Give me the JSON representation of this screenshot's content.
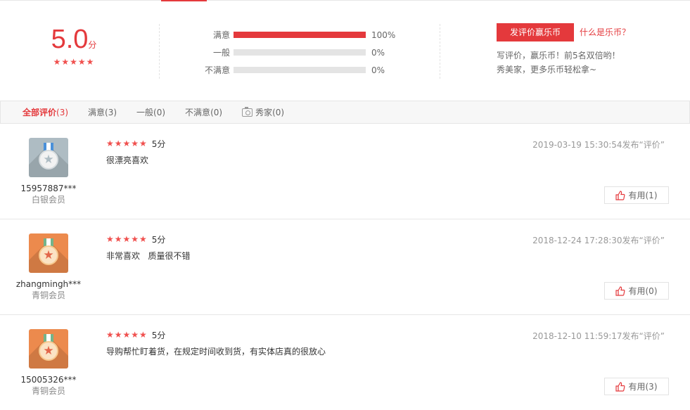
{
  "summary": {
    "score": "5.0",
    "score_unit": "分",
    "stars": "★★★★★",
    "bars": [
      {
        "label": "满意",
        "percent_text": "100%",
        "fill": 1.0
      },
      {
        "label": "一般",
        "percent_text": "0%",
        "fill": 0
      },
      {
        "label": "不满意",
        "percent_text": "0%",
        "fill": 0
      }
    ],
    "promo": {
      "button": "发评价赢乐币",
      "link": "什么是乐币？",
      "line1": "写评价，赢乐币！前5名双倍哟！",
      "line2": "秀美家，更多乐币轻松拿~"
    }
  },
  "tabs": [
    {
      "label": "全部评价",
      "count": "(3)"
    },
    {
      "label": "满意",
      "count": "(3)"
    },
    {
      "label": "一般",
      "count": "(0)"
    },
    {
      "label": "不满意",
      "count": "(0)"
    },
    {
      "label": "秀家",
      "count": "(0)",
      "icon": "camera-icon"
    }
  ],
  "reviews": [
    {
      "user": "15957887***",
      "level": "白银会员",
      "badge": "silver",
      "stars": "★★★★★",
      "score": "5分",
      "text": "很漂亮喜欢",
      "time": "2019-03-19 15:30:54发布“评价”",
      "useful_label": "有用",
      "useful_count": "(1)"
    },
    {
      "user": "zhangmingh***",
      "level": "青铜会员",
      "badge": "bronze",
      "stars": "★★★★★",
      "score": "5分",
      "text": "非常喜欢   质量很不错",
      "time": "2018-12-24 17:28:30发布“评价”",
      "useful_label": "有用",
      "useful_count": "(0)"
    },
    {
      "user": "15005326***",
      "level": "青铜会员",
      "badge": "bronze",
      "stars": "★★★★★",
      "score": "5分",
      "text": "导购帮忙盯着货，在规定时间收到货，有实体店真的很放心",
      "time": "2018-12-10 11:59:17发布“评价”",
      "useful_label": "有用",
      "useful_count": "(3)"
    }
  ],
  "colors": {
    "accent": "#e4393c",
    "star": "#f0504e"
  }
}
